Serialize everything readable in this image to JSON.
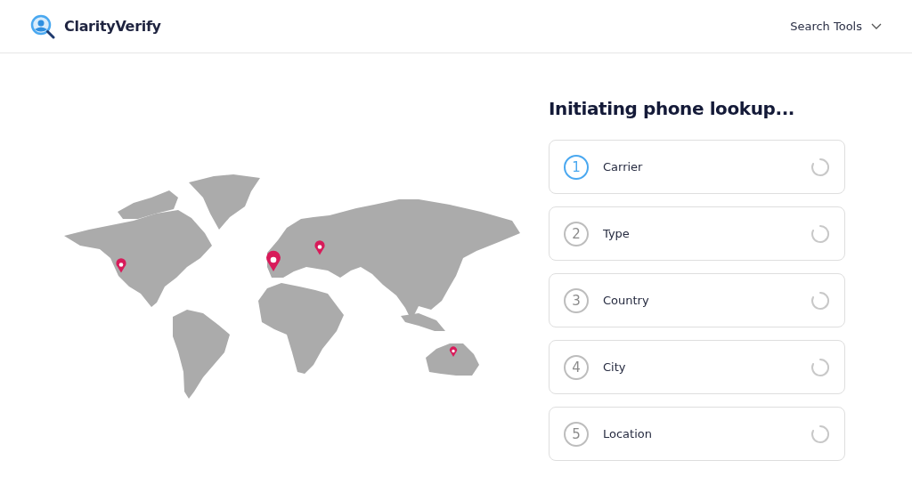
{
  "header": {
    "brand": "ClarityVerify",
    "menu": "Search Tools"
  },
  "lookup": {
    "title": "Initiating phone lookup...",
    "steps": [
      {
        "number": "1",
        "label": "Carrier",
        "active": true
      },
      {
        "number": "2",
        "label": "Type",
        "active": false
      },
      {
        "number": "3",
        "label": "Country",
        "active": false
      },
      {
        "number": "4",
        "label": "City",
        "active": false
      },
      {
        "number": "5",
        "label": "Location",
        "active": false
      }
    ]
  }
}
